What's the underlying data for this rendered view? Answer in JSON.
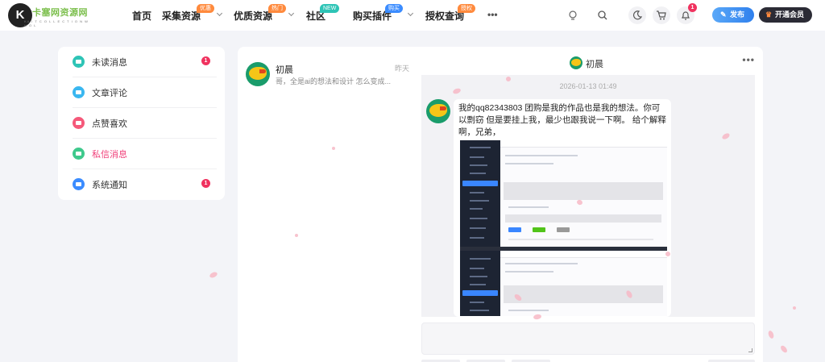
{
  "header": {
    "logo_mark": "K",
    "logo_text": "卡塞网资源网",
    "logo_sub": "KA I T C O L L E C T I O N  W H O L",
    "nav": [
      {
        "label": "首页"
      },
      {
        "label": "采集资源",
        "tag": "优惠"
      },
      {
        "label": "优质资源",
        "tag": "热门"
      },
      {
        "label": "社区",
        "tag": "NEW"
      },
      {
        "label": "购买插件",
        "tag": "购买"
      },
      {
        "label": "授权查询",
        "tag": "授权"
      }
    ],
    "more_label": "•••",
    "notification_count": "1",
    "publish_label": "发布",
    "vip_label": "开通会员",
    "colors": {
      "tag_orange": "#ff8a3d",
      "tag_teal": "#2ec4b6",
      "tag_blue": "#3b8cff",
      "publish": "#2f80ed",
      "vip": "#2b2b35"
    }
  },
  "sidebar": {
    "items": [
      {
        "label": "未读消息",
        "icon": "unread-icon",
        "color": "#2ec4b6",
        "count": "1"
      },
      {
        "label": "文章评论",
        "icon": "comment-icon",
        "color": "#3ab7f0",
        "count": ""
      },
      {
        "label": "点赞喜欢",
        "icon": "heart-icon",
        "color": "#f5597a",
        "count": ""
      },
      {
        "label": "私信消息",
        "icon": "message-icon",
        "color": "#3ec98c",
        "count": "",
        "active": true
      },
      {
        "label": "系统通知",
        "icon": "bell-icon",
        "color": "#3b8cff",
        "count": "1"
      }
    ]
  },
  "conversations": [
    {
      "name": "初晨",
      "time": "昨天",
      "preview": "哥，全是ai的想法和设计 怎么变成..."
    }
  ],
  "chat": {
    "title": "初晨",
    "more_label": "•••",
    "date": "2026-01-13 01:49",
    "message": "我的qq82343803  团购是我的作品也是我的想法。你可以剽窃 但是要挂上我，最少也跟我说一下啊。 给个解释啊，兄弟，"
  }
}
